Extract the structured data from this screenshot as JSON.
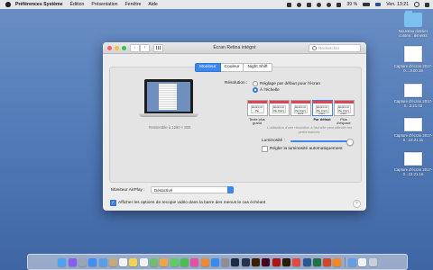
{
  "menubar": {
    "app_name": "Préférences Système",
    "items": [
      "Édition",
      "Présentation",
      "Fenêtre",
      "Aide"
    ],
    "battery": "39 %",
    "clock": "Ven. 13:21"
  },
  "desktop": {
    "items": [
      {
        "label": "Nouveau dossier conten...léments",
        "kind": "folder"
      },
      {
        "label": "Capture d'écran 2017-0....3.00.19",
        "kind": "screenshot"
      },
      {
        "label": "Capture d'écran 2017-0...3.21.03",
        "kind": "screenshot"
      },
      {
        "label": "Capture d'écran 2017-0...13.21.11",
        "kind": "screenshot"
      },
      {
        "label": "Capture d'écran 2017-0...13.21.16",
        "kind": "screenshot"
      }
    ]
  },
  "window": {
    "title": "Écran Retina intégré",
    "search_placeholder": "Rechercher",
    "back_glyph": "‹",
    "forward_glyph": "›",
    "tabs": [
      {
        "label": "Moniteur",
        "active": true
      },
      {
        "label": "Couleur",
        "active": false
      },
      {
        "label": "Night Shift",
        "active": false
      }
    ],
    "resemble_text": "Ressemble à 1280 × 800",
    "resolution": {
      "label": "Résolution :",
      "options": [
        {
          "label": "Réglage par défaut pour l'écran",
          "selected": false
        },
        {
          "label": "À l'échelle",
          "selected": true
        }
      ]
    },
    "scales": [
      {
        "label": "Texte plus grand",
        "sample": "Here's to the",
        "selected": false
      },
      {
        "label": "",
        "sample": "Here's to the crazy",
        "selected": false
      },
      {
        "label": "",
        "sample": "Here's to the crazy ones",
        "selected": false
      },
      {
        "label": "Par défaut",
        "sample": "Here's to the crazy ones. The",
        "selected": true
      },
      {
        "label": "Plus d'espace",
        "sample": "Here's to the crazy ones. The misfits",
        "selected": false
      }
    ],
    "hint": "L'utilisation d'une résolution à l'échelle peut affecter les performances.",
    "luminosity": {
      "label": "Luminosité :",
      "value": 1.0,
      "auto_label": "Régler la luminosité automatiquement",
      "auto_checked": false
    },
    "airplay": {
      "label": "Moniteur AirPlay :",
      "value": "Désactivé"
    },
    "mirroring": {
      "label": "Afficher les options de recopie vidéo dans la barre des menus le cas échéant",
      "checked": true
    },
    "help_glyph": "?"
  },
  "dock": {
    "icons": [
      {
        "name": "finder-icon",
        "color": "#4aa3f0"
      },
      {
        "name": "siri-icon",
        "color": "#8a5cf2"
      },
      {
        "name": "launchpad-icon",
        "color": "#9aa4b2"
      },
      {
        "name": "safari-icon",
        "color": "#3d8ef5"
      },
      {
        "name": "mail-icon",
        "color": "#5aa0e8"
      },
      {
        "name": "contacts-icon",
        "color": "#c9a878"
      },
      {
        "name": "calendar-icon",
        "color": "#f4f4f4"
      },
      {
        "name": "notes-icon",
        "color": "#f5d44c"
      },
      {
        "name": "reminders-icon",
        "color": "#f2f2f2"
      },
      {
        "name": "maps-icon",
        "color": "#6cc26b"
      },
      {
        "name": "photos-icon",
        "color": "#f0a640"
      },
      {
        "name": "messages-icon",
        "color": "#5fcf5a"
      },
      {
        "name": "facetime-icon",
        "color": "#48c04a"
      },
      {
        "name": "itunes-icon",
        "color": "#e94ea0"
      },
      {
        "name": "ibooks-icon",
        "color": "#f08a2c"
      },
      {
        "name": "app-store-icon",
        "color": "#2f8ef0"
      },
      {
        "name": "system-preferences-icon",
        "color": "#8e8e93"
      },
      {
        "name": "photoshop-icon",
        "color": "#1c2c48"
      },
      {
        "name": "lightroom-icon",
        "color": "#24344f"
      },
      {
        "name": "illustrator-icon",
        "color": "#3a2000"
      },
      {
        "name": "indesign-icon",
        "color": "#49021f"
      },
      {
        "name": "acrobat-icon",
        "color": "#b3140c"
      },
      {
        "name": "bridge-icon",
        "color": "#2a1c07"
      },
      {
        "name": "chrome-icon",
        "color": "#e8483b"
      },
      {
        "name": "word-icon",
        "color": "#2b5797"
      },
      {
        "name": "excel-icon",
        "color": "#1f7244"
      },
      {
        "name": "powerpoint-icon",
        "color": "#d24726"
      },
      {
        "name": "vlc-icon",
        "color": "#f28a1c"
      },
      {
        "name": "downloads-icon",
        "color": "#5f9ee8"
      },
      {
        "name": "document-icon",
        "color": "#f2f2f2"
      },
      {
        "name": "trash-icon",
        "color": "#c9ced6"
      }
    ]
  }
}
